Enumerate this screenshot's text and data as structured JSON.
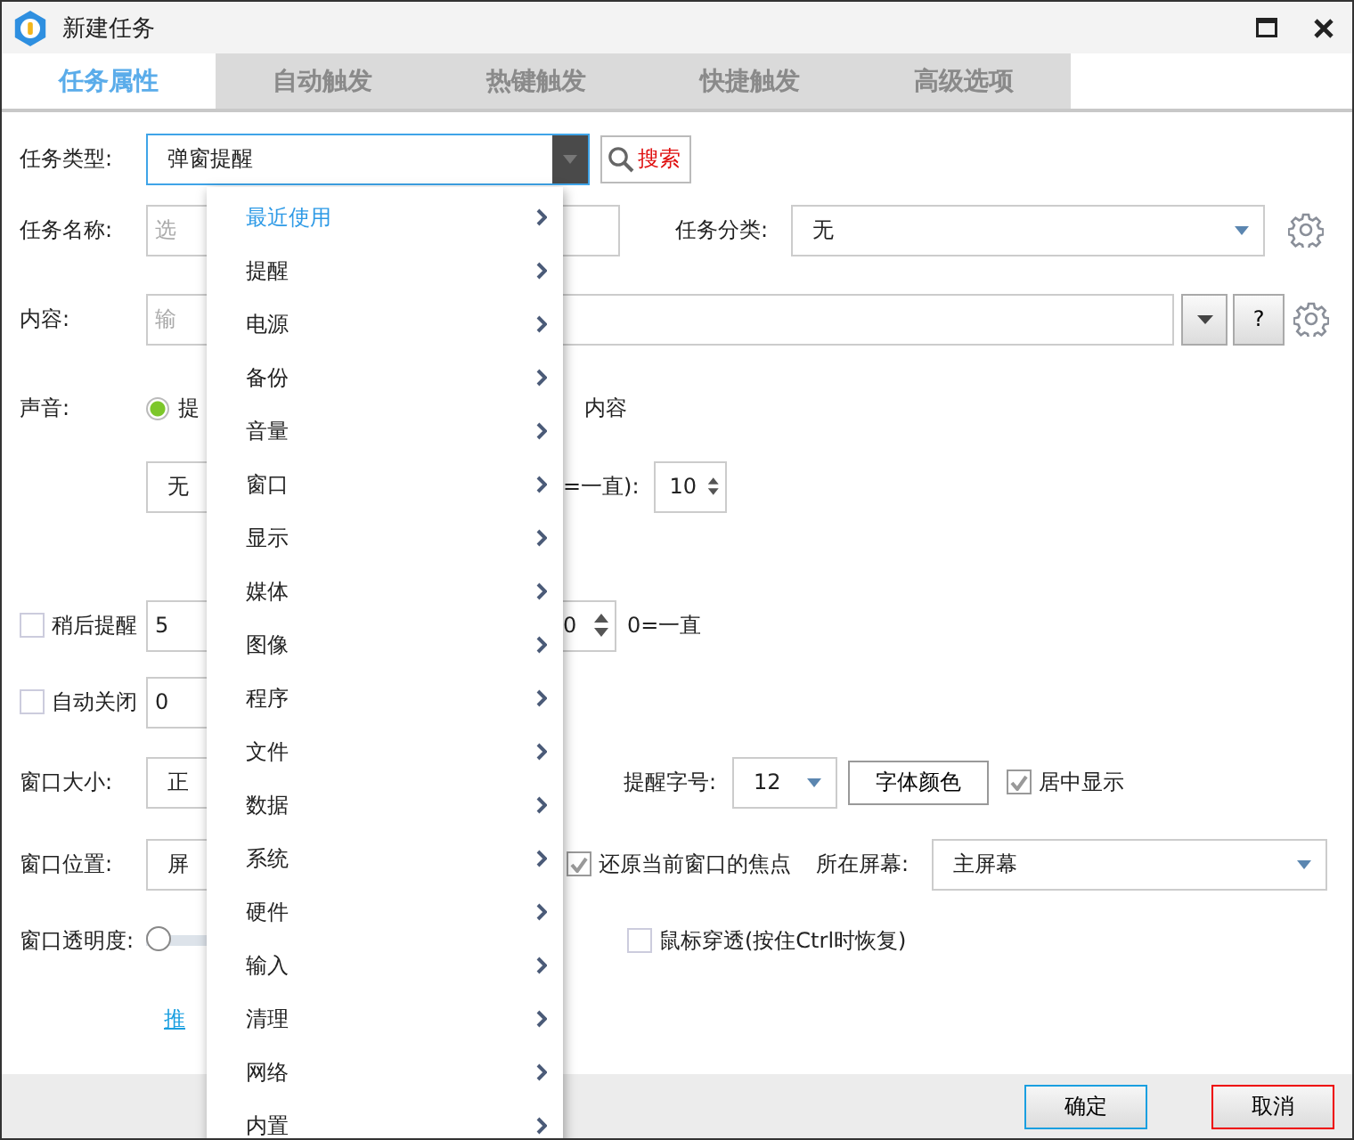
{
  "window": {
    "title": "新建任务"
  },
  "tabs": [
    {
      "label": "任务属性",
      "selected": true
    },
    {
      "label": "自动触发",
      "selected": false
    },
    {
      "label": "热键触发",
      "selected": false
    },
    {
      "label": "快捷触发",
      "selected": false
    },
    {
      "label": "高级选项",
      "selected": false
    }
  ],
  "form": {
    "task_type": {
      "label": "任务类型:",
      "value": "弹窗提醒",
      "search": "搜索"
    },
    "task_name": {
      "label": "任务名称:",
      "placeholder": "选",
      "category_label": "任务分类:",
      "category": "无"
    },
    "content": {
      "label": "内容:",
      "placeholder": "输",
      "help": "?"
    },
    "sound": {
      "label": "声音:",
      "option": {
        "label": "提",
        "selected": true
      },
      "option_tail": "内容",
      "value": "无",
      "repeat_label": "=一直):",
      "repeat": "10"
    },
    "snooze": {
      "label": "稍后提醒",
      "checked": false,
      "value": "5",
      "count": "0",
      "count_note": "0=一直"
    },
    "auto_close": {
      "label": "自动关闭",
      "checked": false,
      "value": "0"
    },
    "window_size": {
      "label": "窗口大小:",
      "value": "正",
      "font_size_label": "提醒字号:",
      "font_size": "12",
      "font_color": "字体颜色",
      "center": {
        "label": "居中显示",
        "checked": true
      }
    },
    "window_position": {
      "label": "窗口位置:",
      "value": "屏",
      "restore_focus": {
        "label": "还原当前窗口的焦点",
        "checked": true
      },
      "screen_label": "所在屏幕:",
      "screen": "主屏幕"
    },
    "opacity": {
      "label": "窗口透明度:",
      "level": 0,
      "click_through": {
        "label": "鼠标穿透(按住Ctrl时恢复)",
        "checked": false
      }
    },
    "link": "推"
  },
  "menu": [
    {
      "label": "最近使用",
      "selected": true
    },
    {
      "label": "提醒",
      "selected": false
    },
    {
      "label": "电源",
      "selected": false
    },
    {
      "label": "备份",
      "selected": false
    },
    {
      "label": "音量",
      "selected": false
    },
    {
      "label": "窗口",
      "selected": false
    },
    {
      "label": "显示",
      "selected": false
    },
    {
      "label": "媒体",
      "selected": false
    },
    {
      "label": "图像",
      "selected": false
    },
    {
      "label": "程序",
      "selected": false
    },
    {
      "label": "文件",
      "selected": false
    },
    {
      "label": "数据",
      "selected": false
    },
    {
      "label": "系统",
      "selected": false
    },
    {
      "label": "硬件",
      "selected": false
    },
    {
      "label": "输入",
      "selected": false
    },
    {
      "label": "清理",
      "selected": false
    },
    {
      "label": "网络",
      "selected": false
    },
    {
      "label": "内置",
      "selected": false
    }
  ],
  "buttons": [
    {
      "label": "确定",
      "kind": "ok"
    },
    {
      "label": "取消",
      "kind": "cancel"
    }
  ]
}
